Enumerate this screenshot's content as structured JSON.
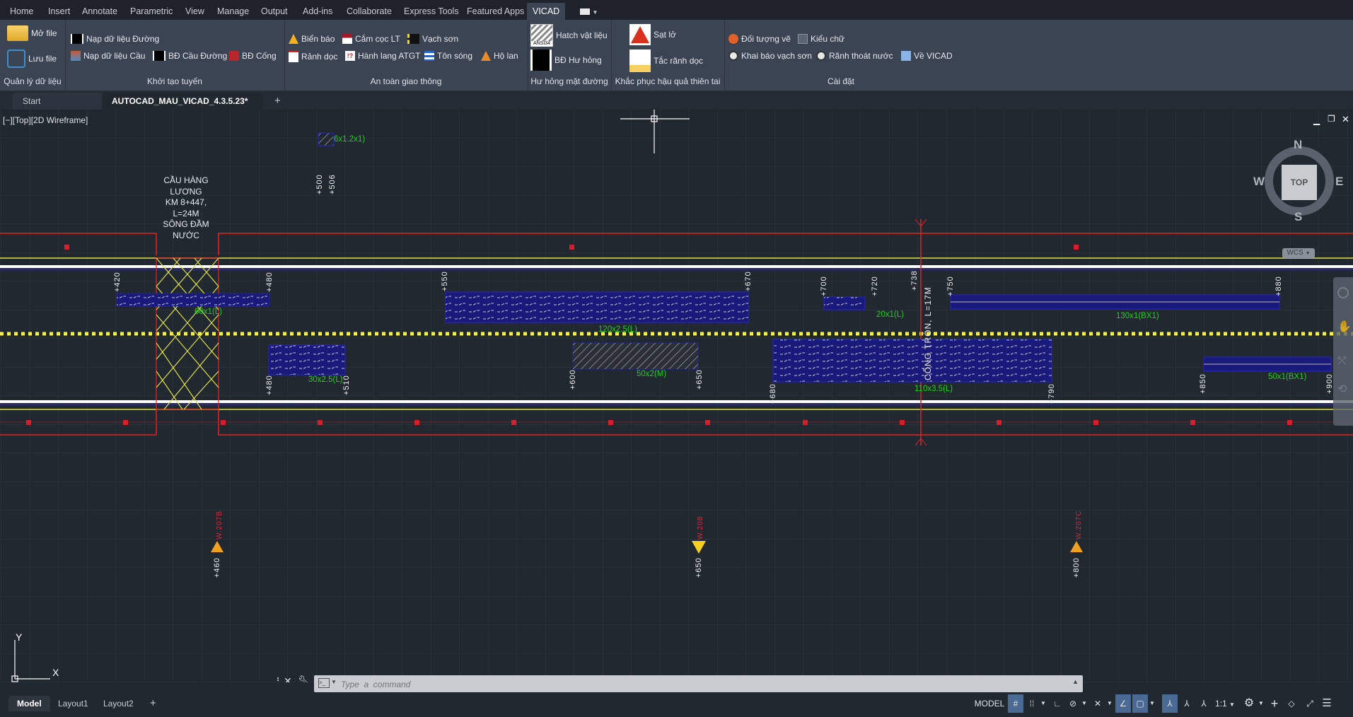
{
  "menu_tabs": [
    "Home",
    "Insert",
    "Annotate",
    "Parametric",
    "View",
    "Manage",
    "Output",
    "Add-ins",
    "Collaborate",
    "Express Tools",
    "Featured Apps",
    "VICAD"
  ],
  "active_menu_tab": "VICAD",
  "ribbon": {
    "panels": [
      {
        "title": "Quản lý dữ liệu",
        "buttons": [
          {
            "label": "Mở file",
            "icon": "folder-icon"
          },
          {
            "label": "Lưu file",
            "icon": "save-icon"
          }
        ]
      },
      {
        "title": "Khởi tạo tuyến",
        "buttons": [
          {
            "label": "Nạp dữ liệu Đường",
            "icon": "road-data-icon"
          },
          {
            "label": "Nạp dữ liệu Cầu",
            "icon": "bridge-data-icon"
          },
          {
            "label": "BĐ Cầu Đường",
            "icon": "bridge-road-icon"
          },
          {
            "label": "BĐ Cống",
            "icon": "culvert-icon"
          }
        ]
      },
      {
        "title": "An toàn giao thông",
        "buttons": [
          {
            "label": "Biển báo",
            "icon": "warning-sign-icon"
          },
          {
            "label": "Cắm cọc LT",
            "icon": "stake-icon"
          },
          {
            "label": "Vạch sơn",
            "icon": "road-paint-icon"
          },
          {
            "label": "Rảnh dọc",
            "icon": "ditch-icon"
          },
          {
            "label": "Hành lang ATGT",
            "icon": "safety-corridor-icon"
          },
          {
            "label": "Tôn sóng",
            "icon": "guardrail-icon"
          },
          {
            "label": "Hộ lan",
            "icon": "cone-icon"
          }
        ]
      },
      {
        "title": "Hư hỏng mặt đường",
        "buttons": [
          {
            "label": "Hatch vật liệu",
            "icon": "hatch-icon",
            "icon_text": "ANSI34"
          },
          {
            "label": "BĐ Hư hỏng",
            "icon": "damage-map-icon"
          }
        ]
      },
      {
        "title": "Khắc phục hậu quả thiên tai",
        "buttons": [
          {
            "label": "Sạt lở",
            "icon": "landslide-icon"
          },
          {
            "label": "Tắc rãnh dọc",
            "icon": "blocked-ditch-icon"
          }
        ]
      },
      {
        "title": "Cài đặt",
        "buttons": [
          {
            "label": "Đối tượng vẽ",
            "icon": "gear-objects-icon"
          },
          {
            "label": "Kiểu chữ",
            "icon": "text-style-icon"
          },
          {
            "label": "Khai báo vạch sơn",
            "icon": "paint-settings-icon"
          },
          {
            "label": "Rãnh thoát nước",
            "icon": "drain-settings-icon"
          },
          {
            "label": "Về VICAD",
            "icon": "info-icon"
          }
        ]
      }
    ]
  },
  "doc_tabs": [
    {
      "label": "Start",
      "active": false
    },
    {
      "label": "AUTOCAD_MAU_VICAD_4.3.5.23*",
      "active": true
    }
  ],
  "viewport": {
    "label": "[−][Top][2D Wireframe]",
    "viewcube": {
      "n": "N",
      "s": "S",
      "e": "E",
      "w": "W",
      "face": "TOP",
      "ucs": "WCS"
    },
    "bridge_label": [
      "CẦU HÀNG",
      "LƯƠNG",
      "KM 8+447,",
      "L=24M",
      "SÔNG ĐẦM",
      "NƯỚC"
    ],
    "culvert_label": "CỐNG TRÒN, L=17M",
    "stations_top": [
      "+420",
      "+480",
      "+500",
      "+506",
      "+550",
      "+670",
      "+700",
      "+720",
      "+738",
      "+750",
      "+880"
    ],
    "stations_bottom": [
      "+480",
      "+510",
      "+600",
      "+650",
      "+680",
      "+790",
      "+850",
      "+900"
    ],
    "damage_labels": [
      "6x1.2x1)",
      "60x1(L)",
      "30x2.5(L)",
      "120x2.5(L)",
      "50x2(M)",
      "20x1(L)",
      "110x3.5(L)",
      "130x1(BX1)",
      "50x1(BX1)"
    ],
    "signs": [
      {
        "station": "+460",
        "code": "W.207B",
        "type": "warning"
      },
      {
        "station": "+650",
        "code": "W.208",
        "type": "yield"
      },
      {
        "station": "+800",
        "code": "W.207C",
        "type": "warning"
      }
    ],
    "ucs_x": "X",
    "ucs_y": "Y"
  },
  "command": {
    "placeholder": "Type  a  command"
  },
  "layout_tabs": [
    "Model",
    "Layout1",
    "Layout2"
  ],
  "status": {
    "model": "MODEL",
    "scale": "1:1"
  },
  "colors": {
    "accent": "#4a6a94",
    "road_edge": "#ff2020",
    "centerline": "#f2f24a",
    "damage_text": "#1fd11f",
    "hatch_border": "#1a1aa8"
  }
}
